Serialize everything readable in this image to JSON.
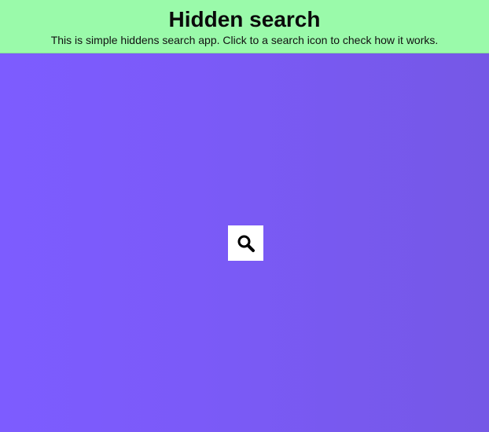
{
  "header": {
    "title": "Hidden search",
    "subtitle": "This is simple hiddens search app. Click to a search icon to check how it works."
  },
  "search": {
    "icon": "search-icon"
  },
  "colors": {
    "header_bg": "#9afaaa",
    "background_start": "#7d5cff",
    "background_end": "#7558e6",
    "button_bg": "#ffffff",
    "icon": "#000000"
  }
}
